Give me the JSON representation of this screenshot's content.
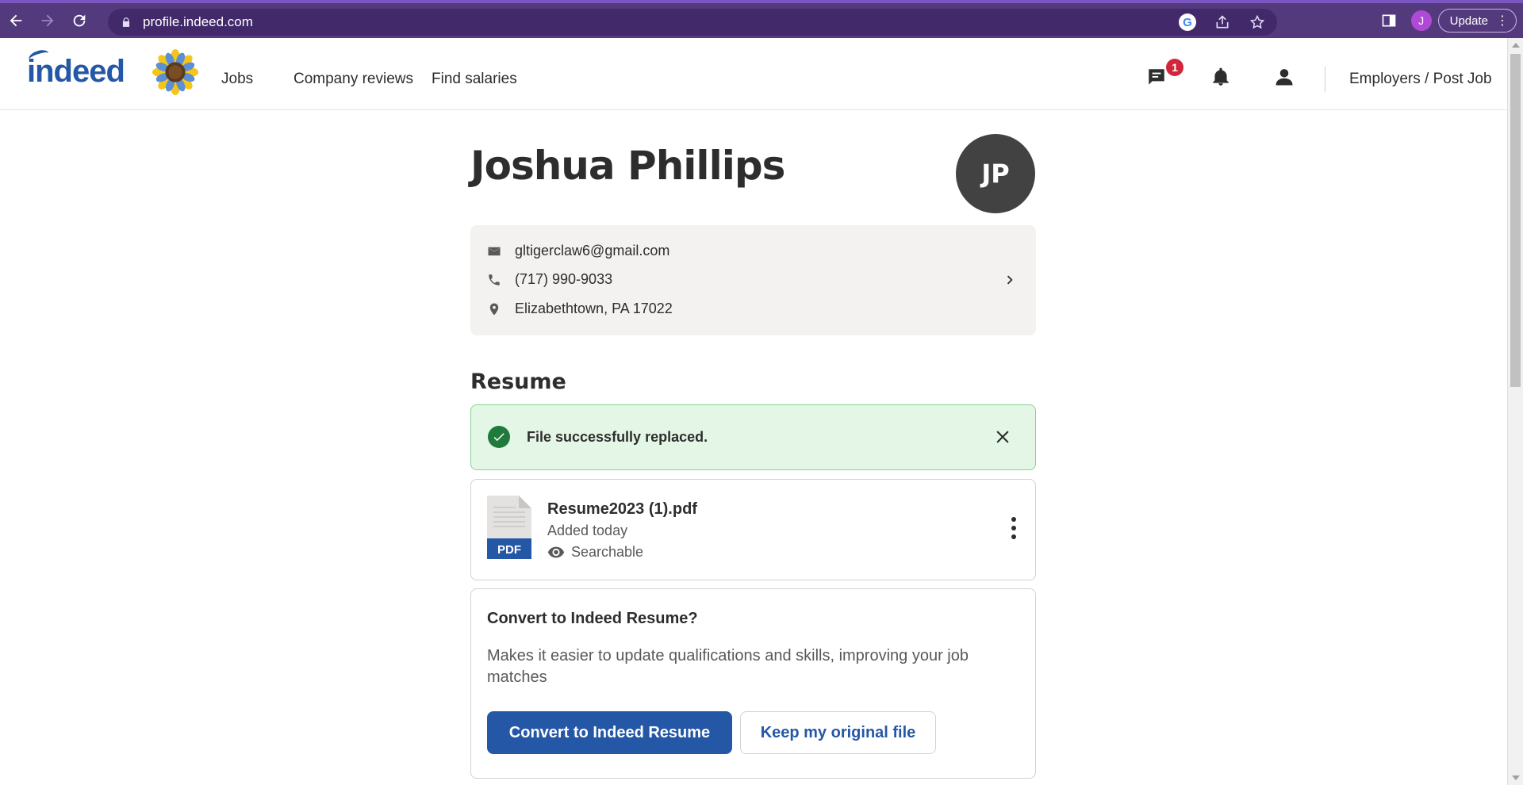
{
  "browser": {
    "url": "profile.indeed.com",
    "profile_initial": "J",
    "update_label": "Update"
  },
  "header": {
    "logo_text": "indeed",
    "nav": [
      "Jobs",
      "Company reviews",
      "Find salaries"
    ],
    "messages_badge": "1",
    "employers_link": "Employers / Post Job"
  },
  "profile": {
    "name": "Joshua Phillips",
    "initials": "JP",
    "email": "gltigerclaw6@gmail.com",
    "phone": "(717) 990-9033",
    "location": "Elizabethtown, PA 17022"
  },
  "resume": {
    "section_title": "Resume",
    "alert_message": "File successfully replaced.",
    "file_name": "Resume2023 (1).pdf",
    "file_type": "PDF",
    "added": "Added today",
    "visibility": "Searchable",
    "convert_title": "Convert to Indeed Resume?",
    "convert_description": "Makes it easier to update qualifications and skills, improving your job matches",
    "convert_button": "Convert to Indeed Resume",
    "keep_button": "Keep my original file"
  },
  "colors": {
    "brand_blue": "#2557a7",
    "browser_purple": "#533a7d",
    "success_green": "#1f7a3c",
    "badge_red": "#d4263b"
  }
}
